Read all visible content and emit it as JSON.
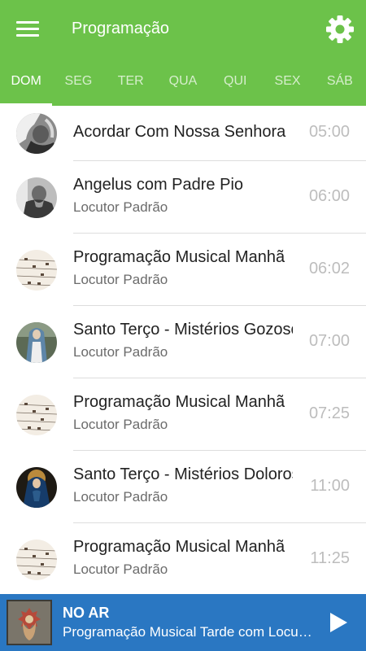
{
  "app": {
    "title": "Programação"
  },
  "tabs": [
    {
      "label": "DOM"
    },
    {
      "label": "SEG"
    },
    {
      "label": "TER"
    },
    {
      "label": "QUA"
    },
    {
      "label": "QUI"
    },
    {
      "label": "SEX"
    },
    {
      "label": "SÁB"
    }
  ],
  "active_tab": "DOM",
  "schedule": [
    {
      "title": "Acordar Com Nossa Senhora",
      "subtitle": "",
      "time": "05:00",
      "image": "nun-photo"
    },
    {
      "title": "Angelus com Padre Pio",
      "subtitle": "Locutor Padrão",
      "time": "06:00",
      "image": "padre-pio-photo"
    },
    {
      "title": "Programação Musical Manhã",
      "subtitle": "Locutor Padrão",
      "time": "06:02",
      "image": "sheet-music-photo"
    },
    {
      "title": "Santo Terço - Mistérios Gozosos",
      "subtitle": "Locutor Padrão",
      "time": "07:00",
      "image": "our-lady-statue-photo"
    },
    {
      "title": "Programação Musical Manhã",
      "subtitle": "Locutor Padrão",
      "time": "07:25",
      "image": "sheet-music-photo"
    },
    {
      "title": "Santo Terço - Mistérios Dolorosos",
      "subtitle": "Locutor Padrão",
      "time": "11:00",
      "image": "our-lady-sorrows-photo"
    },
    {
      "title": "Programação Musical Manhã",
      "subtitle": "Locutor Padrão",
      "time": "11:25",
      "image": "sheet-music-photo"
    }
  ],
  "player": {
    "label": "NO AR",
    "track": "Programação Musical Tarde com Locutor Padrão",
    "icon": "play-icon"
  },
  "colors": {
    "appbar": "#6cc24a",
    "player": "#2a77c2",
    "divider": "#dddddd",
    "time_text": "#bdbdbd"
  }
}
